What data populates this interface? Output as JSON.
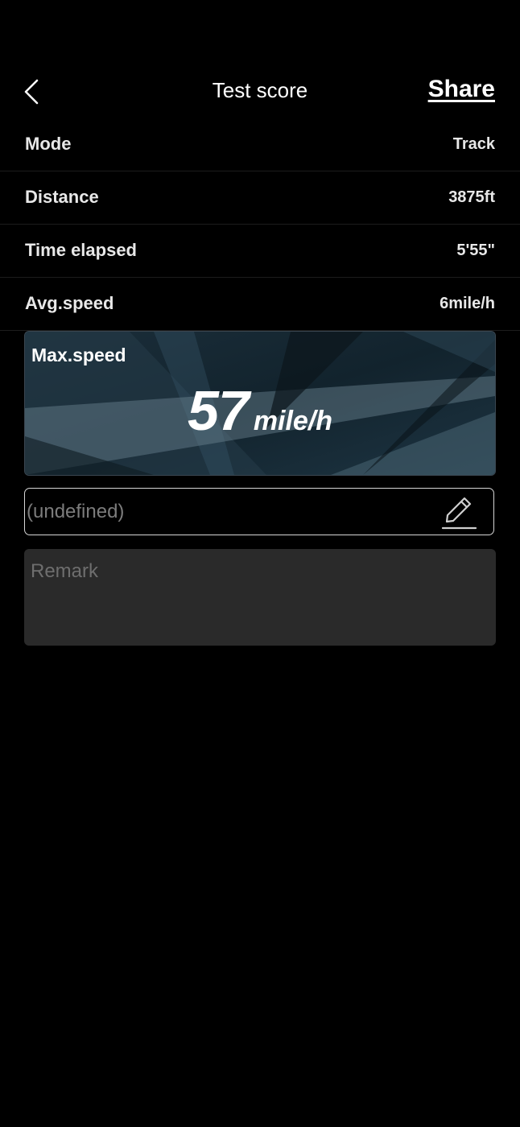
{
  "header": {
    "title": "Test score",
    "share_label": "Share",
    "back_icon": "chevron-left-icon"
  },
  "stats": [
    {
      "label": "Mode",
      "value": "Track"
    },
    {
      "label": "Distance",
      "value": "3875ft"
    },
    {
      "label": "Time elapsed",
      "value": "5'55\""
    },
    {
      "label": "Avg.speed",
      "value": "6mile/h"
    }
  ],
  "max_speed": {
    "label": "Max.speed",
    "value": "57",
    "unit": "mile/h"
  },
  "name_field": {
    "value": "(undefined)",
    "edit_icon": "pencil-icon"
  },
  "remark": {
    "placeholder": "Remark"
  },
  "colors": {
    "background": "#000000",
    "text": "#ffffff",
    "muted_text": "#7c7c7c",
    "card_bg": "#15242e",
    "remark_bg": "#2a2a2a"
  }
}
